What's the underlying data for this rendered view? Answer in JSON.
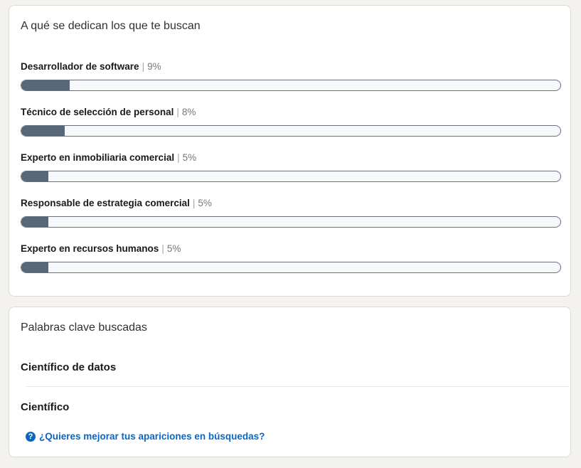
{
  "occupations_card": {
    "title": "A qué se dedican los que te buscan",
    "separator": "|",
    "items": [
      {
        "label": "Desarrollador de software",
        "percent_text": "9%",
        "percent": 9
      },
      {
        "label": "Técnico de selección de personal",
        "percent_text": "8%",
        "percent": 8
      },
      {
        "label": "Experto en inmobiliaria comercial",
        "percent_text": "5%",
        "percent": 5
      },
      {
        "label": "Responsable de estrategia comercial",
        "percent_text": "5%",
        "percent": 5
      },
      {
        "label": "Experto en recursos humanos",
        "percent_text": "5%",
        "percent": 5
      }
    ]
  },
  "keywords_card": {
    "title": "Palabras clave buscadas",
    "keywords": [
      "Científico de datos",
      "Científico"
    ],
    "help_link": {
      "icon": "question-circle-icon",
      "label": "¿Quieres mejorar tus apariciones en búsquedas?"
    }
  },
  "colors": {
    "bar_fill": "#56687a",
    "bar_track": "#f6f8fb",
    "link": "#0a66c2"
  }
}
